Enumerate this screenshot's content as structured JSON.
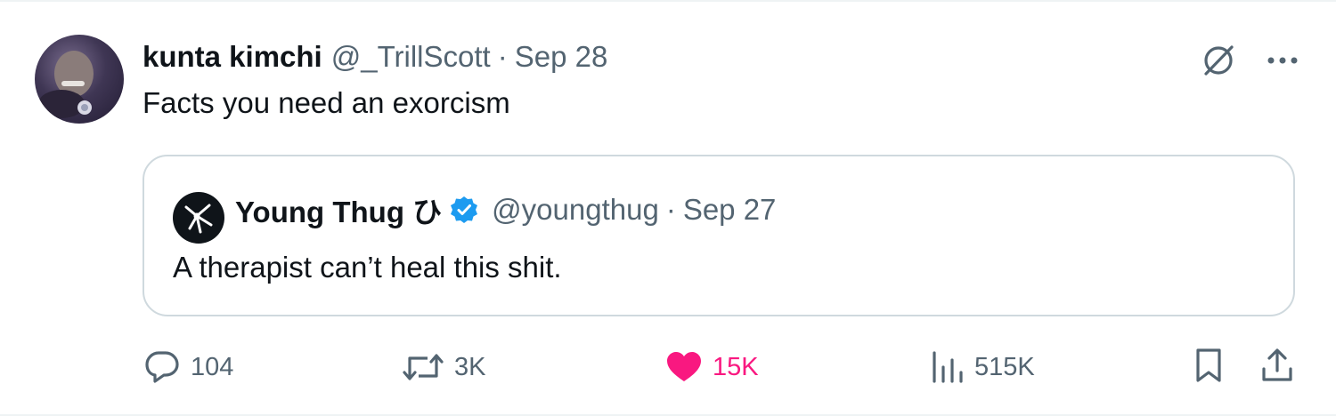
{
  "tweet": {
    "display_name": "kunta kimchi",
    "handle": "@_TrillScott",
    "separator": "·",
    "date": "Sep 28",
    "text": "Facts you need an exorcism"
  },
  "quote": {
    "display_name": "Young Thug ひ",
    "handle": "@youngthug",
    "separator": "·",
    "date": "Sep 27",
    "text": "A therapist can’t heal this shit."
  },
  "actions": {
    "replies": "104",
    "reposts": "3K",
    "likes": "15K",
    "views": "515K"
  },
  "colors": {
    "text_primary": "#0f1419",
    "text_secondary": "#536471",
    "like_pink": "#f91880",
    "verified_blue": "#1d9bf0",
    "border": "#cfd9de"
  },
  "icons": [
    "grok-icon",
    "more-icon",
    "verified-badge-icon",
    "reply-icon",
    "repost-icon",
    "like-icon",
    "views-icon",
    "bookmark-icon",
    "share-icon"
  ]
}
